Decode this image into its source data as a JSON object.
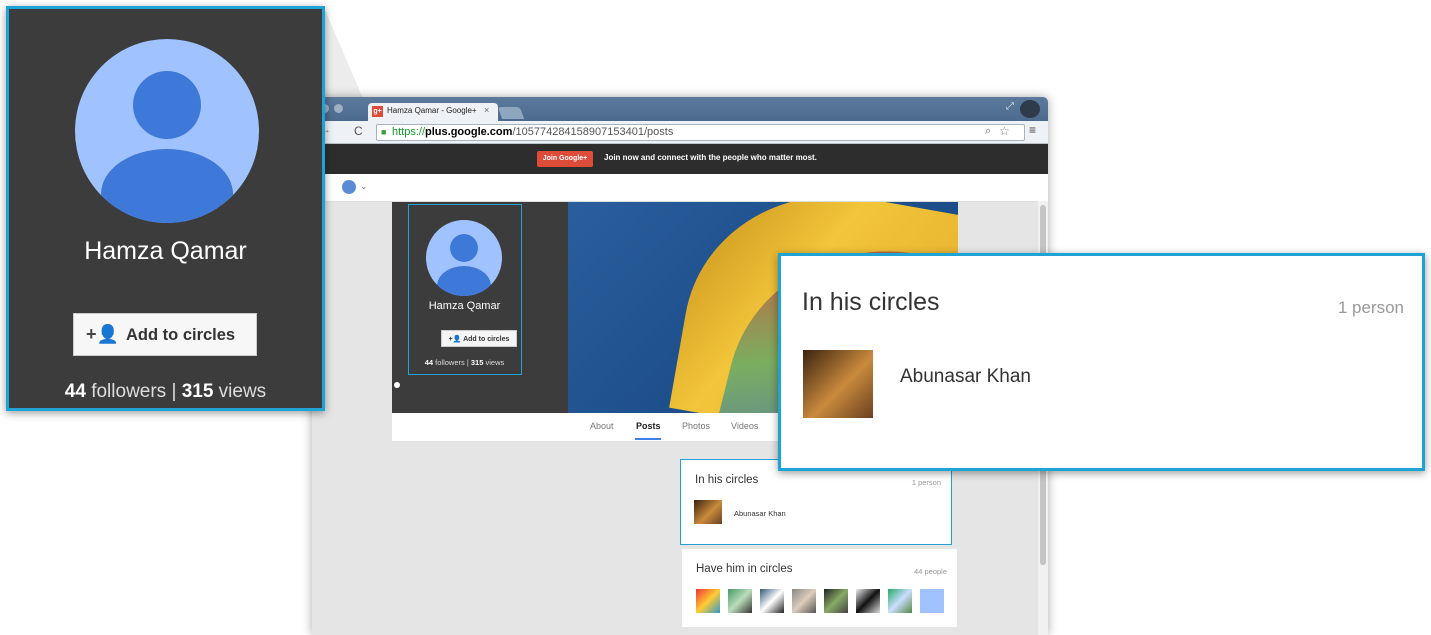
{
  "browser": {
    "tab_title": "Hamza Qamar - Google+",
    "tab_close": "×",
    "url": {
      "scheme": "https://",
      "host": "plus.google.com",
      "path": "/105774284158907153401/posts"
    }
  },
  "promo": {
    "join_label": "Join Google+",
    "text": "Join now and connect with the people who matter most."
  },
  "profile": {
    "name": "Hamza Qamar",
    "add_label": "Add to circles",
    "followers": "44",
    "followers_label": " followers | ",
    "views": "315",
    "views_label": " views"
  },
  "tabs": [
    "About",
    "Posts",
    "Photos",
    "Videos"
  ],
  "in_circles": {
    "title": "In his circles",
    "count": "1 person",
    "person": "Abunasar Khan"
  },
  "have_in_circles": {
    "title": "Have him in circles",
    "count": "44 people"
  },
  "colors": {
    "accent": "#22a3d3",
    "google_red": "#dd4b39",
    "avatar_light": "#a0c3ff",
    "avatar_dark": "#3e78d8"
  }
}
